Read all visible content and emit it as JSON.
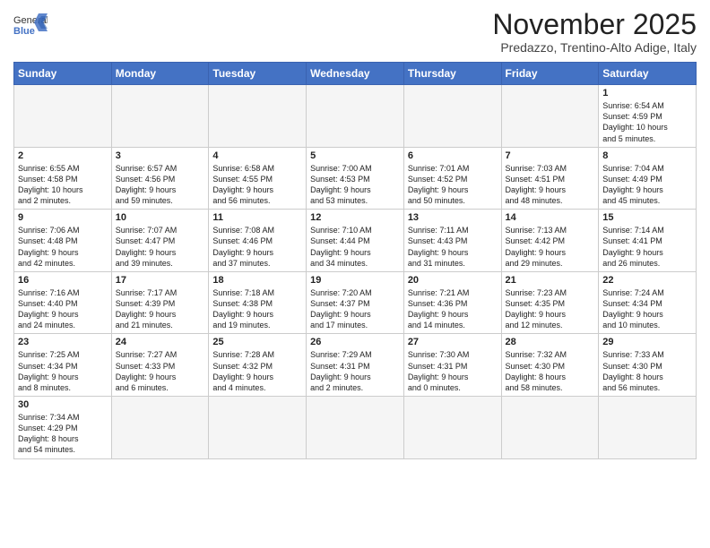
{
  "header": {
    "logo_line1": "General",
    "logo_line2": "Blue",
    "month_title": "November 2025",
    "location": "Predazzo, Trentino-Alto Adige, Italy"
  },
  "weekdays": [
    "Sunday",
    "Monday",
    "Tuesday",
    "Wednesday",
    "Thursday",
    "Friday",
    "Saturday"
  ],
  "weeks": [
    [
      {
        "day": "",
        "info": ""
      },
      {
        "day": "",
        "info": ""
      },
      {
        "day": "",
        "info": ""
      },
      {
        "day": "",
        "info": ""
      },
      {
        "day": "",
        "info": ""
      },
      {
        "day": "",
        "info": ""
      },
      {
        "day": "1",
        "info": "Sunrise: 6:54 AM\nSunset: 4:59 PM\nDaylight: 10 hours\nand 5 minutes."
      }
    ],
    [
      {
        "day": "2",
        "info": "Sunrise: 6:55 AM\nSunset: 4:58 PM\nDaylight: 10 hours\nand 2 minutes."
      },
      {
        "day": "3",
        "info": "Sunrise: 6:57 AM\nSunset: 4:56 PM\nDaylight: 9 hours\nand 59 minutes."
      },
      {
        "day": "4",
        "info": "Sunrise: 6:58 AM\nSunset: 4:55 PM\nDaylight: 9 hours\nand 56 minutes."
      },
      {
        "day": "5",
        "info": "Sunrise: 7:00 AM\nSunset: 4:53 PM\nDaylight: 9 hours\nand 53 minutes."
      },
      {
        "day": "6",
        "info": "Sunrise: 7:01 AM\nSunset: 4:52 PM\nDaylight: 9 hours\nand 50 minutes."
      },
      {
        "day": "7",
        "info": "Sunrise: 7:03 AM\nSunset: 4:51 PM\nDaylight: 9 hours\nand 48 minutes."
      },
      {
        "day": "8",
        "info": "Sunrise: 7:04 AM\nSunset: 4:49 PM\nDaylight: 9 hours\nand 45 minutes."
      }
    ],
    [
      {
        "day": "9",
        "info": "Sunrise: 7:06 AM\nSunset: 4:48 PM\nDaylight: 9 hours\nand 42 minutes."
      },
      {
        "day": "10",
        "info": "Sunrise: 7:07 AM\nSunset: 4:47 PM\nDaylight: 9 hours\nand 39 minutes."
      },
      {
        "day": "11",
        "info": "Sunrise: 7:08 AM\nSunset: 4:46 PM\nDaylight: 9 hours\nand 37 minutes."
      },
      {
        "day": "12",
        "info": "Sunrise: 7:10 AM\nSunset: 4:44 PM\nDaylight: 9 hours\nand 34 minutes."
      },
      {
        "day": "13",
        "info": "Sunrise: 7:11 AM\nSunset: 4:43 PM\nDaylight: 9 hours\nand 31 minutes."
      },
      {
        "day": "14",
        "info": "Sunrise: 7:13 AM\nSunset: 4:42 PM\nDaylight: 9 hours\nand 29 minutes."
      },
      {
        "day": "15",
        "info": "Sunrise: 7:14 AM\nSunset: 4:41 PM\nDaylight: 9 hours\nand 26 minutes."
      }
    ],
    [
      {
        "day": "16",
        "info": "Sunrise: 7:16 AM\nSunset: 4:40 PM\nDaylight: 9 hours\nand 24 minutes."
      },
      {
        "day": "17",
        "info": "Sunrise: 7:17 AM\nSunset: 4:39 PM\nDaylight: 9 hours\nand 21 minutes."
      },
      {
        "day": "18",
        "info": "Sunrise: 7:18 AM\nSunset: 4:38 PM\nDaylight: 9 hours\nand 19 minutes."
      },
      {
        "day": "19",
        "info": "Sunrise: 7:20 AM\nSunset: 4:37 PM\nDaylight: 9 hours\nand 17 minutes."
      },
      {
        "day": "20",
        "info": "Sunrise: 7:21 AM\nSunset: 4:36 PM\nDaylight: 9 hours\nand 14 minutes."
      },
      {
        "day": "21",
        "info": "Sunrise: 7:23 AM\nSunset: 4:35 PM\nDaylight: 9 hours\nand 12 minutes."
      },
      {
        "day": "22",
        "info": "Sunrise: 7:24 AM\nSunset: 4:34 PM\nDaylight: 9 hours\nand 10 minutes."
      }
    ],
    [
      {
        "day": "23",
        "info": "Sunrise: 7:25 AM\nSunset: 4:34 PM\nDaylight: 9 hours\nand 8 minutes."
      },
      {
        "day": "24",
        "info": "Sunrise: 7:27 AM\nSunset: 4:33 PM\nDaylight: 9 hours\nand 6 minutes."
      },
      {
        "day": "25",
        "info": "Sunrise: 7:28 AM\nSunset: 4:32 PM\nDaylight: 9 hours\nand 4 minutes."
      },
      {
        "day": "26",
        "info": "Sunrise: 7:29 AM\nSunset: 4:31 PM\nDaylight: 9 hours\nand 2 minutes."
      },
      {
        "day": "27",
        "info": "Sunrise: 7:30 AM\nSunset: 4:31 PM\nDaylight: 9 hours\nand 0 minutes."
      },
      {
        "day": "28",
        "info": "Sunrise: 7:32 AM\nSunset: 4:30 PM\nDaylight: 8 hours\nand 58 minutes."
      },
      {
        "day": "29",
        "info": "Sunrise: 7:33 AM\nSunset: 4:30 PM\nDaylight: 8 hours\nand 56 minutes."
      }
    ],
    [
      {
        "day": "30",
        "info": "Sunrise: 7:34 AM\nSunset: 4:29 PM\nDaylight: 8 hours\nand 54 minutes."
      },
      {
        "day": "",
        "info": ""
      },
      {
        "day": "",
        "info": ""
      },
      {
        "day": "",
        "info": ""
      },
      {
        "day": "",
        "info": ""
      },
      {
        "day": "",
        "info": ""
      },
      {
        "day": "",
        "info": ""
      }
    ]
  ]
}
